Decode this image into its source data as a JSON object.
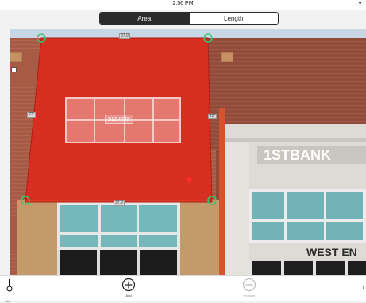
{
  "status_bar": {
    "time": "2:56 PM",
    "battery_indicator": "▼"
  },
  "segmented_control": {
    "options": [
      {
        "label": "Area",
        "selected": true
      },
      {
        "label": "Length",
        "selected": false
      }
    ]
  },
  "overlay": {
    "area_label": "912.05ft²",
    "edge_labels": {
      "top": "37.9",
      "left": "22'",
      "right": "22'",
      "bottom": "37.9"
    },
    "fill_color": "#e0261a",
    "handle_color": "#2ecc71",
    "point_color": "#ff2d2d"
  },
  "background_photo": {
    "bank_sign_text": "1STBANK",
    "bank_street_text": "WEST EN"
  },
  "toolbar": {
    "left_label": "Inf",
    "add_label": "Add",
    "remove_label": "Remove",
    "right_glyph": "›"
  }
}
